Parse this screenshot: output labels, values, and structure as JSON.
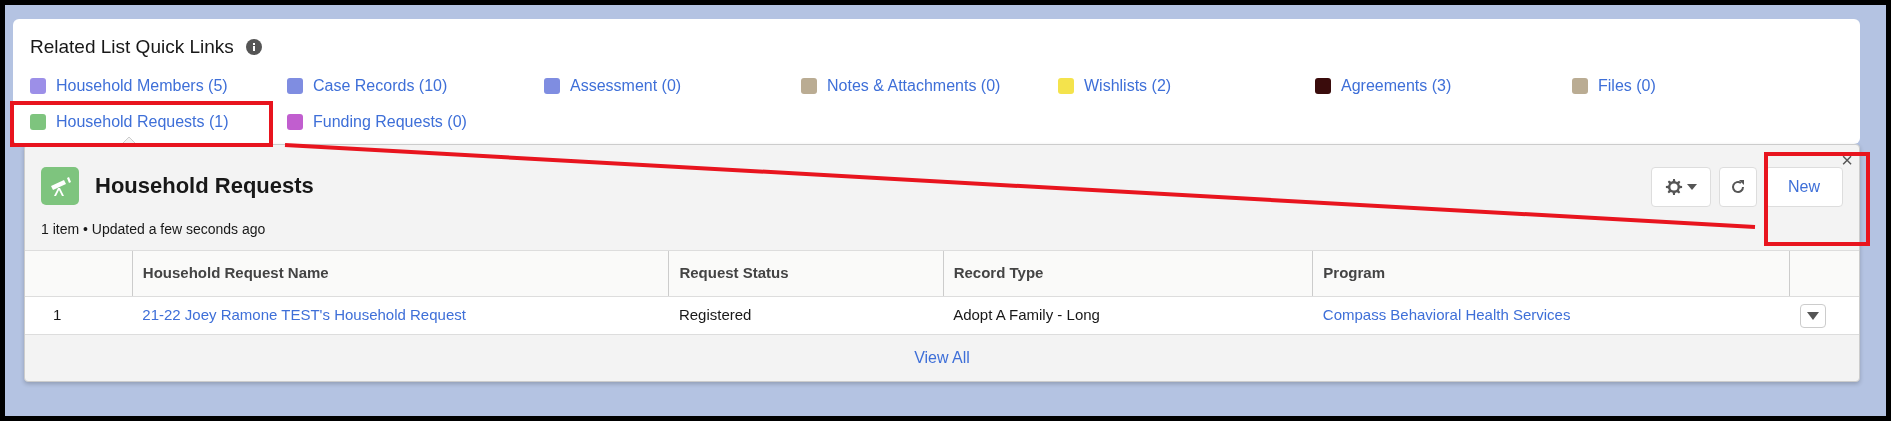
{
  "card": {
    "title": "Related List Quick Links"
  },
  "quick_links": [
    {
      "label": "Household Members (5)",
      "color": "#9c8fe8",
      "selected": false
    },
    {
      "label": "Case Records (10)",
      "color": "#7f8de1",
      "selected": false
    },
    {
      "label": "Assessment (0)",
      "color": "#7f8de1",
      "selected": false
    },
    {
      "label": "Notes & Attachments (0)",
      "color": "#baac93",
      "selected": false
    },
    {
      "label": "Wishlists (2)",
      "color": "#f4e34c",
      "selected": false
    },
    {
      "label": "Agreements (3)",
      "color": "#3a0c0c",
      "selected": false
    },
    {
      "label": "Files (0)",
      "color": "#baac93",
      "selected": false
    },
    {
      "label": "Household Requests (1)",
      "color": "#7ec47e",
      "selected": true
    },
    {
      "label": "Funding Requests (0)",
      "color": "#c15ecf",
      "selected": false
    }
  ],
  "panel": {
    "title": "Household Requests",
    "subtitle": "1 item • Updated a few seconds ago",
    "close": "×",
    "new_button": "New",
    "footer_link": "View All"
  },
  "table": {
    "columns": [
      "Household Request Name",
      "Request Status",
      "Record Type",
      "Program"
    ],
    "rows": [
      {
        "number": "1",
        "name": "21-22 Joey Ramone TEST's Household Request",
        "status": "Registered",
        "record_type": "Adopt A Family - Long",
        "program": "Compass Behavioral Health Services"
      }
    ]
  }
}
